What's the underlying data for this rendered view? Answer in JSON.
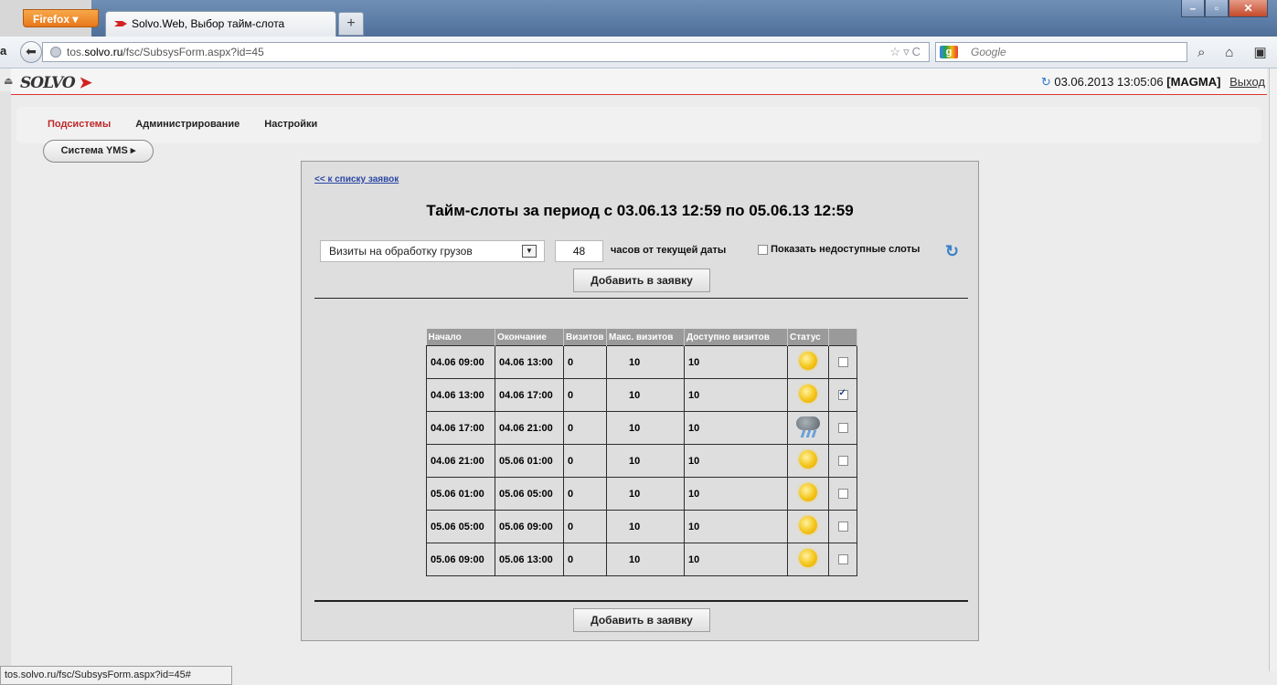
{
  "browser": {
    "firefox_button": "Firefox",
    "tab_title": "Solvo.Web, Выбор тайм-слота",
    "new_tab": "+",
    "url_prefix": "tos.",
    "url_domain": "solvo.ru",
    "url_path": "/fsc/SubsysForm.aspx?id=45",
    "search_placeholder": "Google",
    "status_url": "tos.solvo.ru/fsc/SubsysForm.aspx?id=45#",
    "left_clip_text": "a"
  },
  "app": {
    "logo": "SOLVO",
    "datetime": "03.06.2013 13:05:06",
    "user": "[MAGMA]",
    "logout": "Выход"
  },
  "menu": {
    "items": [
      "Подсистемы",
      "Администрирование",
      "Настройки"
    ],
    "active_index": 0,
    "system_button": "Система YMS ▸"
  },
  "form": {
    "back_link": "<< к списку заявок",
    "heading": "Тайм-слоты за период с 03.06.13 12:59 по 05.06.13 12:59",
    "visit_type": "Визиты на обработку грузов",
    "hours_value": "48",
    "hours_label": "часов от текущей даты",
    "show_unavailable_label": "Показать недоступные слоты",
    "add_button": "Добавить в заявку"
  },
  "table": {
    "headers": [
      "Начало",
      "Окончание",
      "Визитов",
      "Макс. визитов",
      "Доступно визитов",
      "Статус",
      ""
    ],
    "rows": [
      {
        "start": "04.06 09:00",
        "end": "04.06 13:00",
        "visits": "0",
        "max": "10",
        "available": "10",
        "status": "sun",
        "checked": false
      },
      {
        "start": "04.06 13:00",
        "end": "04.06 17:00",
        "visits": "0",
        "max": "10",
        "available": "10",
        "status": "sun",
        "checked": true
      },
      {
        "start": "04.06 17:00",
        "end": "04.06 21:00",
        "visits": "0",
        "max": "10",
        "available": "10",
        "status": "storm",
        "checked": false
      },
      {
        "start": "04.06 21:00",
        "end": "05.06 01:00",
        "visits": "0",
        "max": "10",
        "available": "10",
        "status": "sun",
        "checked": false
      },
      {
        "start": "05.06 01:00",
        "end": "05.06 05:00",
        "visits": "0",
        "max": "10",
        "available": "10",
        "status": "sun",
        "checked": false
      },
      {
        "start": "05.06 05:00",
        "end": "05.06 09:00",
        "visits": "0",
        "max": "10",
        "available": "10",
        "status": "sun",
        "checked": false
      },
      {
        "start": "05.06 09:00",
        "end": "05.06 13:00",
        "visits": "0",
        "max": "10",
        "available": "10",
        "status": "sun",
        "checked": false
      }
    ]
  }
}
